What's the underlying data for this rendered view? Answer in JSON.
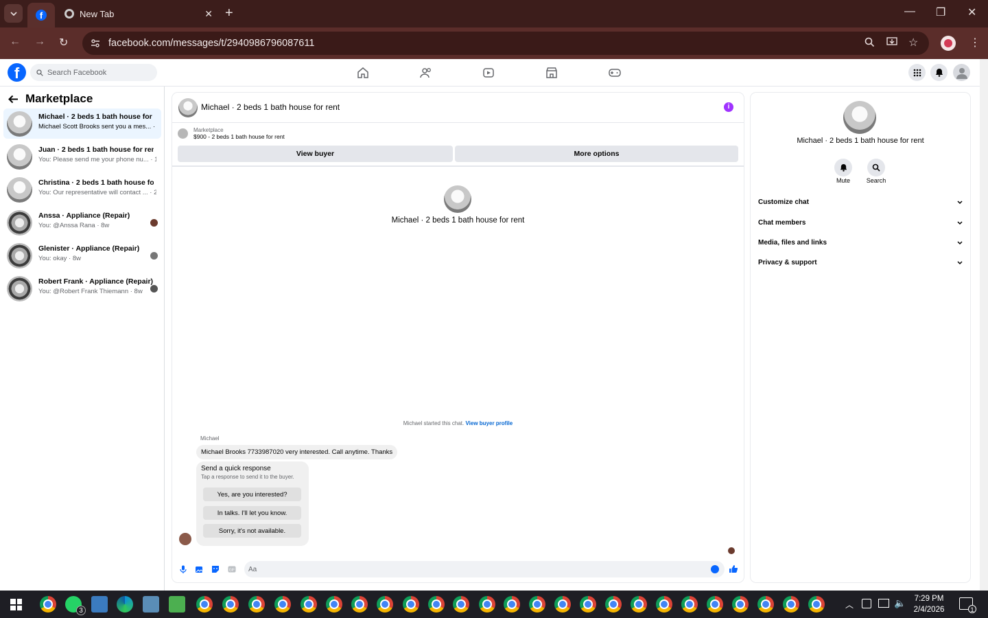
{
  "browser": {
    "tab_title": "New Tab",
    "url": "facebook.com/messages/t/2940986796087611"
  },
  "fb": {
    "search_placeholder": "Search Facebook"
  },
  "sidebar": {
    "title": "Marketplace",
    "conversations": [
      {
        "name": "Michael · 2 beds 1 bath house for r...",
        "preview": "Michael Scott Brooks sent you a mes... · 12h"
      },
      {
        "name": "Juan · 2 beds 1 bath house for rent",
        "preview": "You: Please send me your phone nu... · 16h"
      },
      {
        "name": "Christina · 2 beds 1 bath house for ...",
        "preview": "You: Our representative will contact ... · 23h"
      },
      {
        "name": "Anssa · Appliance (Repair)",
        "preview": "You: @Anssa Rana · 8w"
      },
      {
        "name": "Glenister · Appliance (Repair)",
        "preview": "You: okay · 8w"
      },
      {
        "name": "Robert Frank · Appliance (Repair)",
        "preview": "You: @Robert Frank Thiemann · 8w"
      }
    ]
  },
  "chat": {
    "title": "Michael · 2 beds 1 bath house for rent",
    "marketplace_label": "Marketplace",
    "listing": "$900 - 2 beds 1 bath house for rent",
    "view_buyer": "View buyer",
    "more_options": "More options",
    "center_title": "Michael · 2 beds 1 bath house for rent",
    "started_text": "Michael started this chat.",
    "view_buyer_profile": "View buyer profile",
    "sender": "Michael",
    "message": "Michael Brooks 7733987020 very interested. Call anytime. Thanks",
    "quick_title": "Send a quick response",
    "quick_sub": "Tap a response to send it to the buyer.",
    "quick_responses": [
      "Yes, are you interested?",
      "In talks. I'll let you know.",
      "Sorry, it's not available."
    ],
    "input_placeholder": "Aa"
  },
  "details": {
    "title": "Michael · 2 beds 1 bath house for rent",
    "mute": "Mute",
    "search": "Search",
    "sections": [
      "Customize chat",
      "Chat members",
      "Media, files and links",
      "Privacy & support"
    ]
  },
  "taskbar": {
    "time": "7:29 PM",
    "date": "2/4/2026",
    "whatsapp_badge": "3",
    "notif_badge": "1"
  }
}
